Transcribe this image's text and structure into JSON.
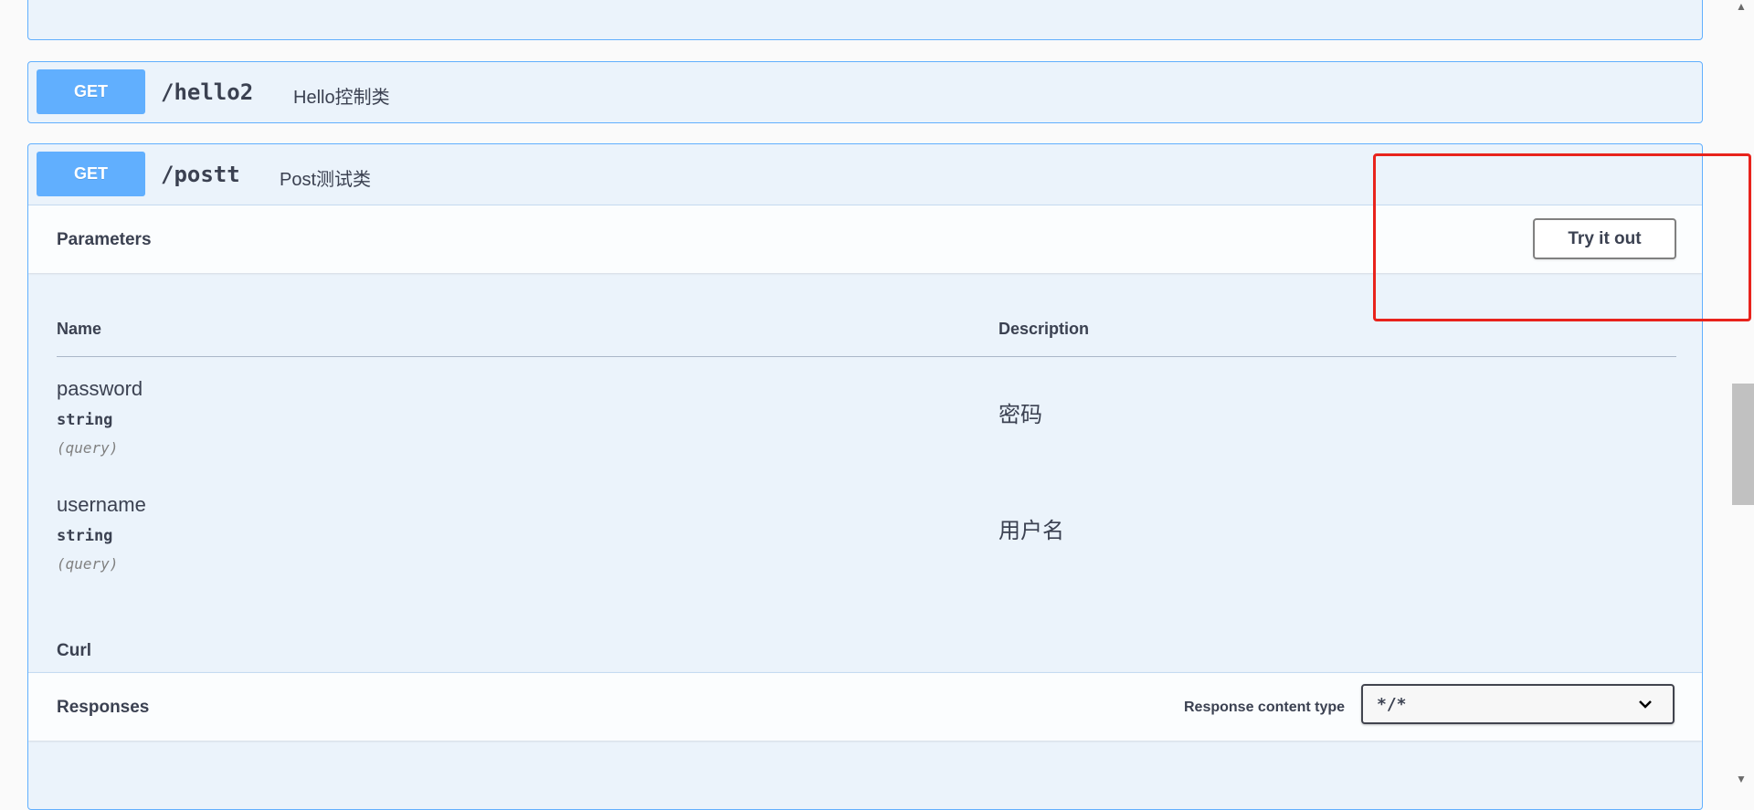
{
  "operations": [
    {
      "method": "GET",
      "path": "/hello2",
      "description": "Hello控制类"
    },
    {
      "method": "GET",
      "path": "/postt",
      "description": "Post测试类"
    }
  ],
  "parameters": {
    "title": "Parameters",
    "try_button": "Try it out",
    "headers": {
      "name": "Name",
      "description": "Description"
    },
    "rows": [
      {
        "name": "password",
        "type": "string",
        "in": "(query)",
        "description": "密码"
      },
      {
        "name": "username",
        "type": "string",
        "in": "(query)",
        "description": "用户名"
      }
    ]
  },
  "responses": {
    "title": "Responses",
    "content_type_label": "Response content type",
    "content_type_value": "*/*"
  },
  "curl_label": "Curl",
  "colors": {
    "get": "#61affe",
    "highlight": "#e8231c"
  }
}
